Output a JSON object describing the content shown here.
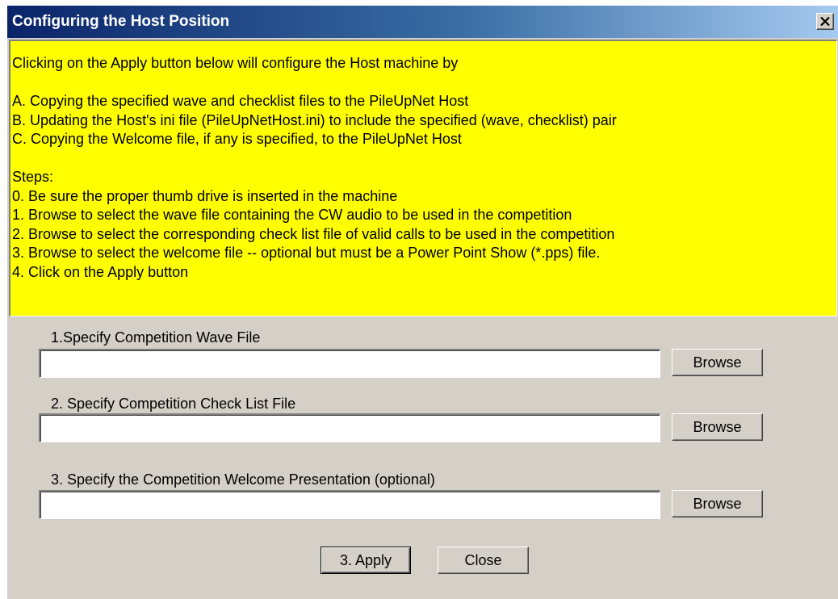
{
  "window": {
    "title": "Configuring the Host Position",
    "close_glyph": "✕"
  },
  "info": {
    "lines": [
      "Clicking on the Apply button below will configure the Host machine by",
      "",
      "A. Copying the specified wave and checklist files to the PileUpNet Host",
      "B. Updating the Host's ini file (PileUpNetHost.ini) to include the specified (wave, checklist) pair",
      "C. Copying the Welcome file, if any is specified, to the PileUpNet Host",
      "",
      "Steps:",
      "0. Be sure the proper thumb drive is inserted in the machine",
      "1. Browse to select the wave file containing the CW audio to be used in the competition",
      "2. Browse to select the corresponding check list file of valid calls to be used in the competition",
      "3. Browse to select the welcome file -- optional but must be a Power Point Show (*.pps) file.",
      "4. Click on the Apply button"
    ]
  },
  "wave_file": {
    "label": "1.Specify Competition Wave File",
    "value": "",
    "browse_label": "Browse"
  },
  "checklist_file": {
    "label": "2. Specify Competition Check List File",
    "value": "",
    "browse_label": "Browse"
  },
  "welcome_file": {
    "label": "3. Specify the Competition Welcome Presentation (optional)",
    "value": "",
    "browse_label": "Browse"
  },
  "actions": {
    "apply_label": "3. Apply",
    "close_label": "Close"
  },
  "colors": {
    "info_background": "#ffff00",
    "dialog_face": "#d4d0c8",
    "title_gradient_start": "#0a246a",
    "title_gradient_end": "#a6caf0"
  }
}
